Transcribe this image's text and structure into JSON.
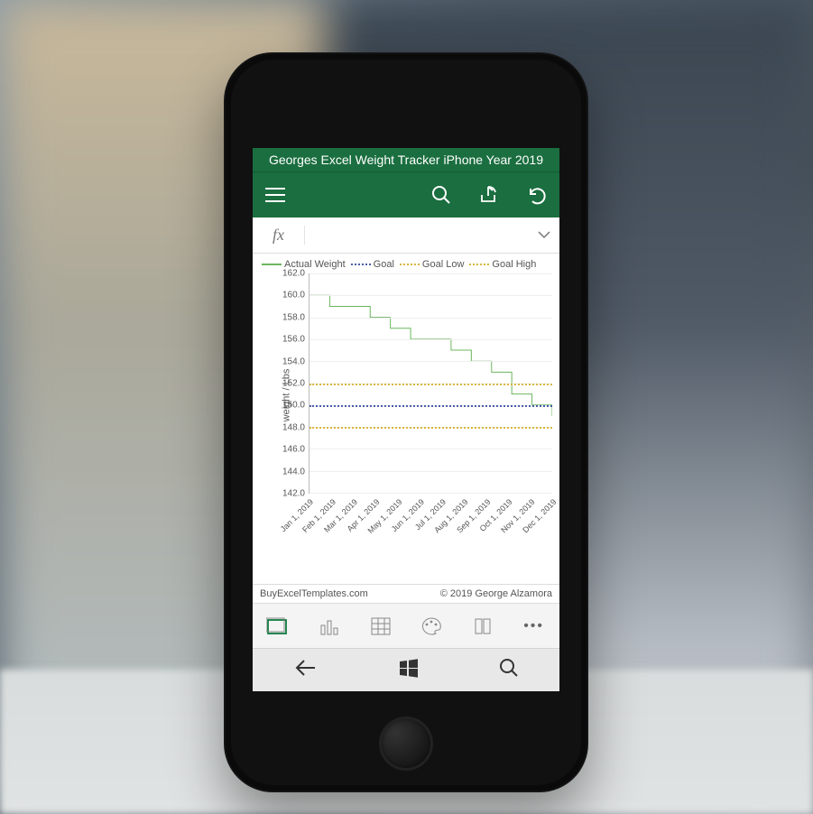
{
  "header": {
    "title": "Georges Excel Weight Tracker iPhone Year 2019"
  },
  "formula_bar": {
    "fx": "fx",
    "value": ""
  },
  "legend": [
    {
      "label": "Actual Weight",
      "style": "solid",
      "color": "#6cb65e"
    },
    {
      "label": "Goal",
      "style": "dotted",
      "color": "#4a5da8"
    },
    {
      "label": "Goal Low",
      "style": "dotted",
      "color": "#d9b63e"
    },
    {
      "label": "Goal High",
      "style": "dotted",
      "color": "#d9b63e"
    }
  ],
  "footer": {
    "left": "BuyExcelTemplates.com",
    "right": "© 2019 George Alzamora"
  },
  "chart_data": {
    "type": "line",
    "title": "",
    "xlabel": "",
    "ylabel": "weight / Lbs",
    "ylim": [
      142,
      162
    ],
    "yticks": [
      142,
      144,
      146,
      148,
      150,
      152,
      154,
      156,
      158,
      160,
      162
    ],
    "ytick_labels": [
      "142.0",
      "144.0",
      "146.0",
      "148.0",
      "150.0",
      "152.0",
      "154.0",
      "156.0",
      "158.0",
      "160.0",
      "162.0"
    ],
    "categories": [
      "Jan 1, 2019",
      "Feb 1, 2019",
      "Mar 1, 2019",
      "Apr 1, 2019",
      "May 1, 2019",
      "Jun 1, 2019",
      "Jul 1, 2019",
      "Aug 1, 2019",
      "Sep 1, 2019",
      "Oct 1, 2019",
      "Nov 1, 2019",
      "Dec 1, 2019"
    ],
    "series": [
      {
        "name": "Actual Weight",
        "type": "step",
        "color": "#6cb65e",
        "values": [
          160,
          159,
          159,
          158,
          157,
          156,
          156,
          155,
          154,
          153,
          151,
          150,
          149
        ]
      },
      {
        "name": "Goal",
        "type": "ref",
        "color": "#4a5da8",
        "value": 150
      },
      {
        "name": "Goal Low",
        "type": "ref",
        "color": "#d9b63e",
        "value": 148
      },
      {
        "name": "Goal High",
        "type": "ref",
        "color": "#d9b63e",
        "value": 152
      }
    ]
  }
}
